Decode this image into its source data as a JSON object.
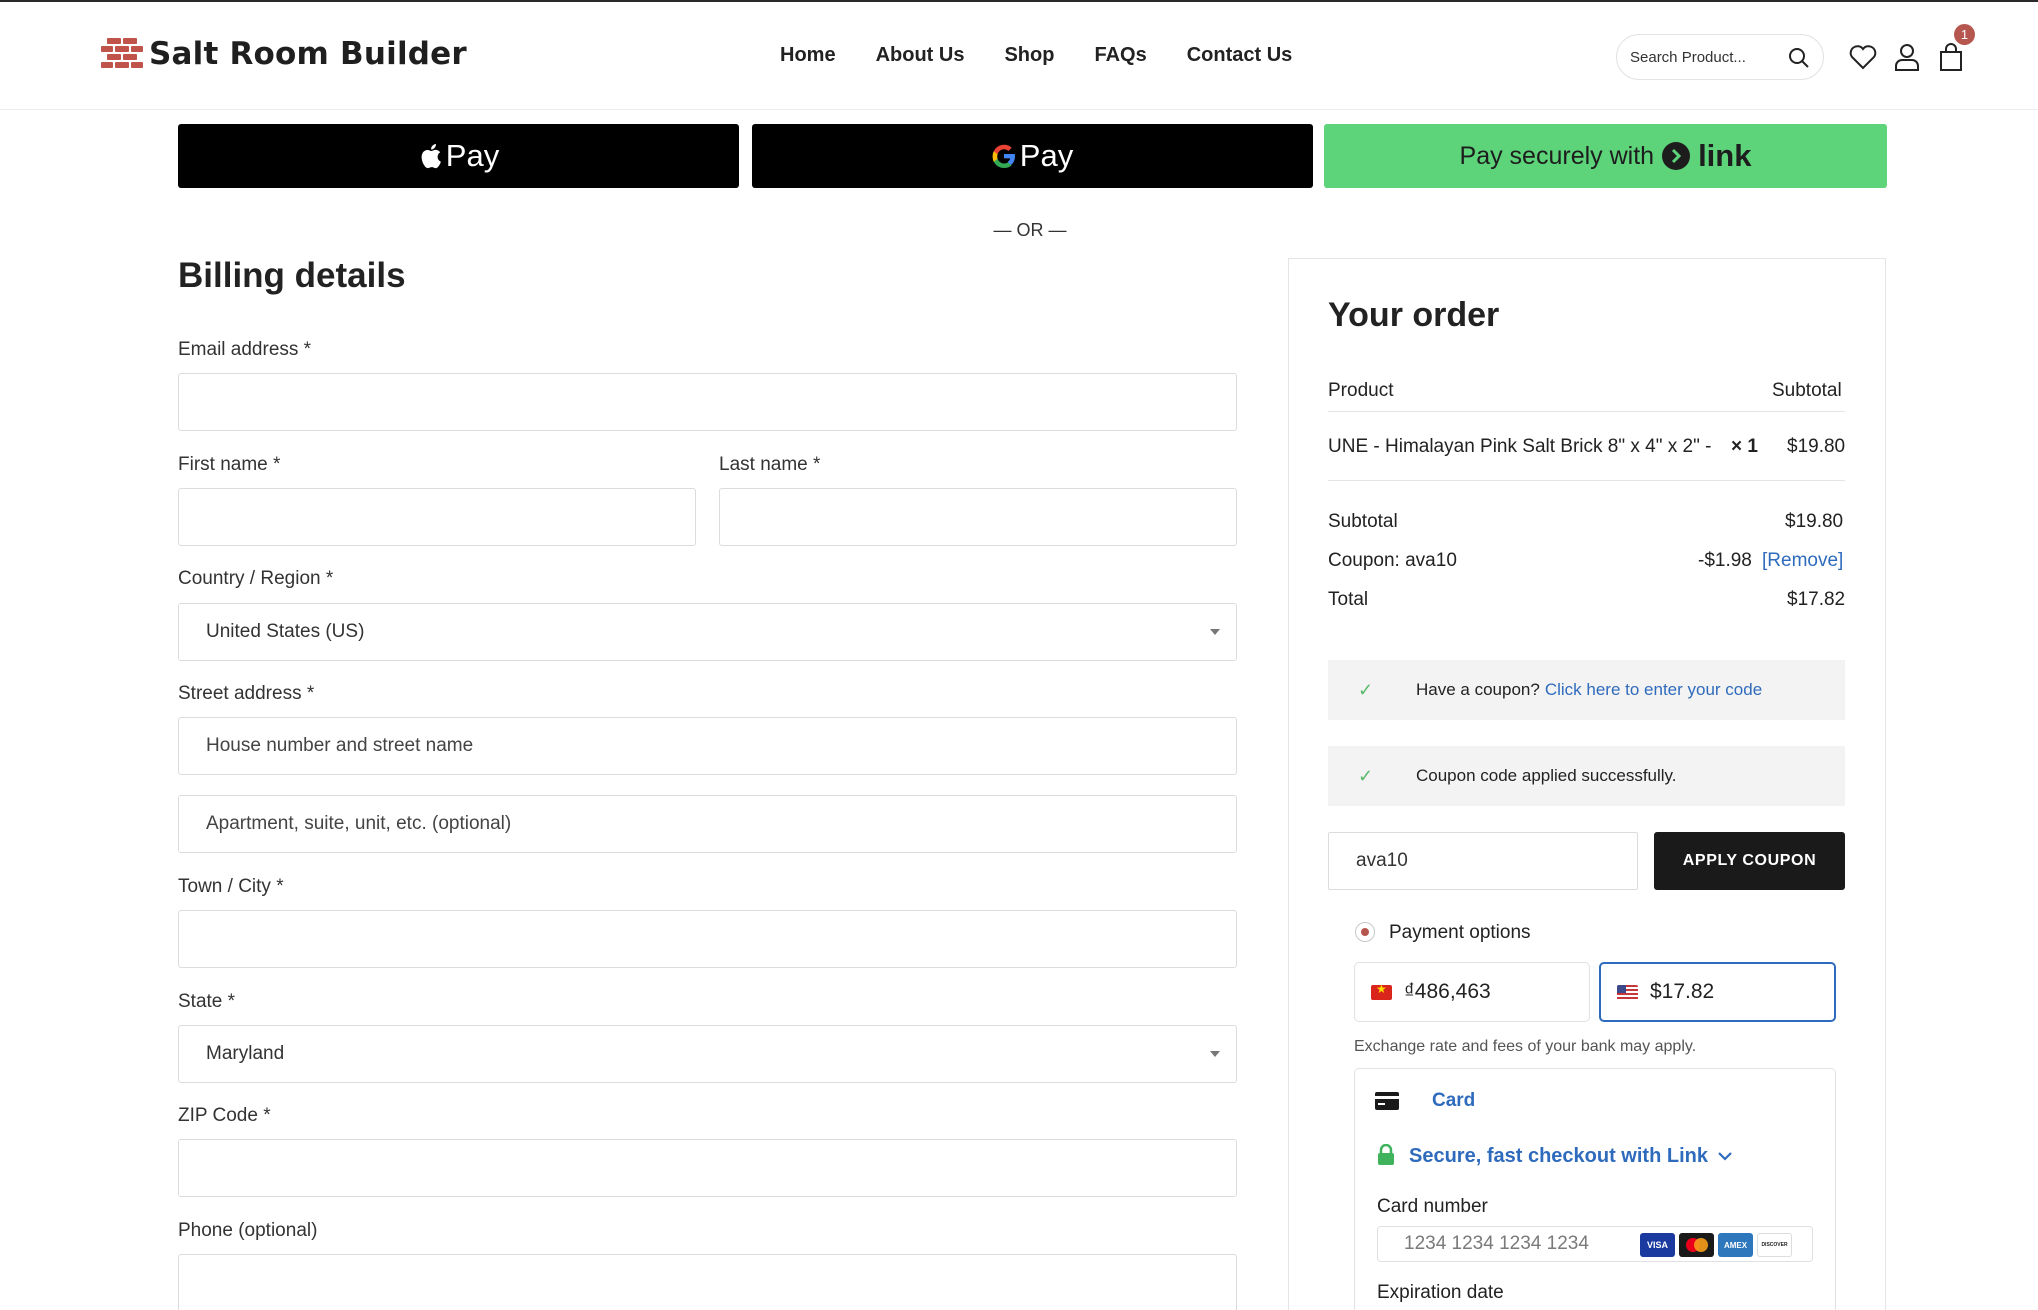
{
  "header": {
    "site_title": "Salt Room Builder",
    "nav": [
      {
        "label": "Home"
      },
      {
        "label": "About Us"
      },
      {
        "label": "Shop"
      },
      {
        "label": "FAQs"
      },
      {
        "label": "Contact Us"
      }
    ],
    "search_placeholder": "Search Product...",
    "cart_count": "1"
  },
  "express_checkout": {
    "apple_pay_label": "Pay",
    "google_pay_label": "Pay",
    "link_label": "Pay securely with",
    "link_brand": "link",
    "separator": "— OR —"
  },
  "billing": {
    "title": "Billing details",
    "email_label": "Email address *",
    "first_name_label": "First name *",
    "last_name_label": "Last name *",
    "country_label": "Country / Region *",
    "country_value": "United States (US)",
    "street_label": "Street address *",
    "street_placeholder": "House number and street name",
    "apartment_placeholder": "Apartment, suite, unit, etc. (optional)",
    "city_label": "Town / City *",
    "state_label": "State *",
    "state_value": "Maryland",
    "zip_label": "ZIP Code *",
    "phone_label": "Phone (optional)"
  },
  "order": {
    "title": "Your order",
    "col_product": "Product",
    "col_subtotal": "Subtotal",
    "item_name": "UNE - Himalayan Pink Salt Brick 8\" x 4\" x 2\" -",
    "item_qty": "× 1",
    "item_price": "$19.80",
    "subtotal_label": "Subtotal",
    "subtotal_value": "$19.80",
    "coupon_label": "Coupon: ava10",
    "coupon_value": "-$1.98",
    "coupon_remove": "[Remove]",
    "total_label": "Total",
    "total_value": "$17.82",
    "have_coupon_text": "Have a coupon?",
    "have_coupon_link": "Click here to enter your code",
    "coupon_applied": "Coupon code applied successfully.",
    "coupon_input_value": "ava10",
    "apply_coupon": "APPLY COUPON",
    "payment_options": "Payment options",
    "price_vnd": "₫486,463",
    "price_usd": "$17.82",
    "exchange_note": "Exchange rate and fees of your bank may apply.",
    "card_tab": "Card",
    "link_checkout": "Secure, fast checkout with Link",
    "card_number_label": "Card number",
    "card_number_placeholder": "1234 1234 1234 1234",
    "card_brands": [
      "VISA",
      "MC",
      "AMEX",
      "DISCOVER"
    ],
    "expiration_label": "Expiration date"
  },
  "colors": {
    "accent_red": "#b5574f",
    "link_green": "#5dd37a",
    "link_blue": "#2f6bbd"
  }
}
